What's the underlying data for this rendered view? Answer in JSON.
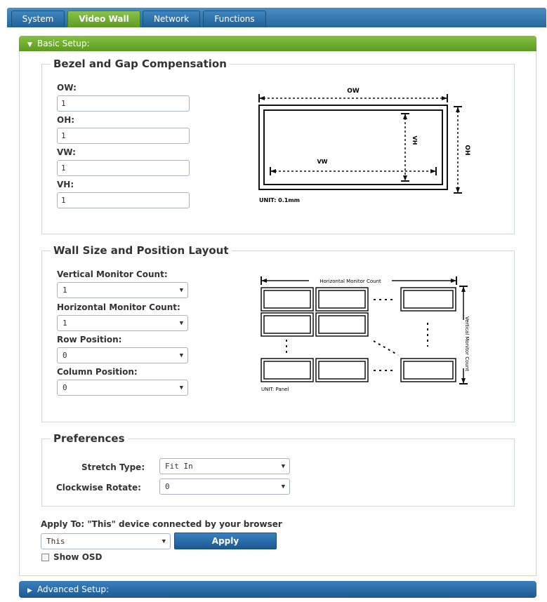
{
  "tabs": [
    {
      "label": "System",
      "active": false
    },
    {
      "label": "Video Wall",
      "active": true
    },
    {
      "label": "Network",
      "active": false
    },
    {
      "label": "Functions",
      "active": false
    }
  ],
  "basic_setup": {
    "label": "Basic Setup:"
  },
  "bezel": {
    "legend": "Bezel and Gap Compensation",
    "ow_label": "OW:",
    "ow_value": "1",
    "oh_label": "OH:",
    "oh_value": "1",
    "vw_label": "VW:",
    "vw_value": "1",
    "vh_label": "VH:",
    "vh_value": "1",
    "diagram": {
      "ow": "OW",
      "oh": "OH",
      "vw": "VW",
      "vh": "VH",
      "unit": "UNIT: 0.1mm"
    }
  },
  "wall": {
    "legend": "Wall Size and Position Layout",
    "vertical_label": "Vertical Monitor Count:",
    "vertical_value": "1",
    "horizontal_label": "Horizontal Monitor Count:",
    "horizontal_value": "1",
    "row_label": "Row Position:",
    "row_value": "0",
    "column_label": "Column Position:",
    "column_value": "0",
    "diagram": {
      "horizontal": "Horizontal Monitor Count",
      "vertical": "Vertical Monitor Count",
      "unit": "UNIT: Panel"
    }
  },
  "preferences": {
    "legend": "Preferences",
    "stretch_label": "Stretch Type:",
    "stretch_value": "Fit In",
    "rotate_label": "Clockwise Rotate:",
    "rotate_value": "0"
  },
  "apply": {
    "label": "Apply To: \"This\" device connected by your browser",
    "target_value": "This",
    "button": "Apply",
    "show_osd": "Show OSD"
  },
  "advanced_setup": {
    "label": "Advanced Setup:"
  },
  "colors": {
    "accent_green": "#6aa82d",
    "accent_blue": "#2a6aa6"
  }
}
